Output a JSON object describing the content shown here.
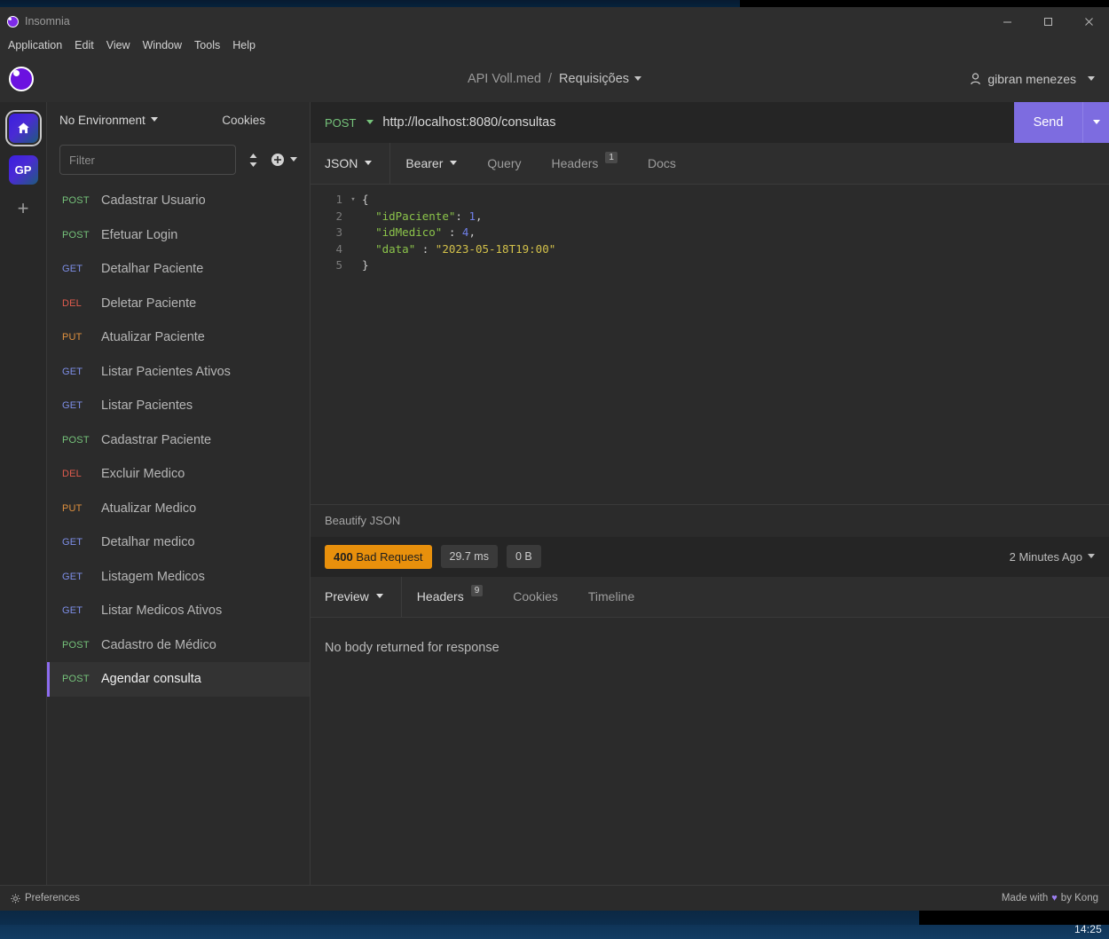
{
  "desktop": {
    "clock": "14:25"
  },
  "window": {
    "title": "Insomnia",
    "controls": {
      "minimize": "minimize-button",
      "maximize": "maximize-button",
      "close": "close-button"
    }
  },
  "menubar": {
    "items": [
      "Application",
      "Edit",
      "View",
      "Window",
      "Tools",
      "Help"
    ]
  },
  "header": {
    "workspace": "API Voll.med",
    "separator": "/",
    "collection": "Requisições",
    "account": "gibran menezes"
  },
  "rail": {
    "home_label": "",
    "project_label": "GP",
    "add_label": "+"
  },
  "sidebar": {
    "environment": "No Environment",
    "cookies": "Cookies",
    "filter_placeholder": "Filter",
    "filter_value": "",
    "requests": [
      {
        "method": "POST",
        "name": "Cadastrar Usuario",
        "selected": false
      },
      {
        "method": "POST",
        "name": "Efetuar Login",
        "selected": false
      },
      {
        "method": "GET",
        "name": "Detalhar Paciente",
        "selected": false
      },
      {
        "method": "DEL",
        "name": "Deletar Paciente",
        "selected": false
      },
      {
        "method": "PUT",
        "name": "Atualizar Paciente",
        "selected": false
      },
      {
        "method": "GET",
        "name": "Listar Pacientes Ativos",
        "selected": false
      },
      {
        "method": "GET",
        "name": "Listar Pacientes",
        "selected": false
      },
      {
        "method": "POST",
        "name": "Cadastrar Paciente",
        "selected": false
      },
      {
        "method": "DEL",
        "name": "Excluir Medico",
        "selected": false
      },
      {
        "method": "PUT",
        "name": "Atualizar Medico",
        "selected": false
      },
      {
        "method": "GET",
        "name": "Detalhar medico",
        "selected": false
      },
      {
        "method": "GET",
        "name": "Listagem Medicos",
        "selected": false
      },
      {
        "method": "GET",
        "name": "Listar Medicos Ativos",
        "selected": false
      },
      {
        "method": "POST",
        "name": "Cadastro de Médico",
        "selected": false
      },
      {
        "method": "POST",
        "name": "Agendar consulta",
        "selected": true
      }
    ]
  },
  "request": {
    "method": "POST",
    "url": "http://localhost:8080/consultas",
    "send_label": "Send",
    "tabs": [
      {
        "label": "JSON",
        "badge": "",
        "caret": true
      },
      {
        "label": "Bearer",
        "badge": "",
        "caret": true
      },
      {
        "label": "Query",
        "badge": "",
        "caret": false
      },
      {
        "label": "Headers",
        "badge": "1",
        "caret": false
      },
      {
        "label": "Docs",
        "badge": "",
        "caret": false
      }
    ],
    "body_lines": [
      {
        "n": "1",
        "fold": "▾",
        "tokens": [
          {
            "t": "{",
            "c": "punc"
          }
        ]
      },
      {
        "n": "2",
        "fold": "",
        "tokens": [
          {
            "t": "  ",
            "c": "punc"
          },
          {
            "t": "\"idPaciente\"",
            "c": "key"
          },
          {
            "t": ": ",
            "c": "punc"
          },
          {
            "t": "1",
            "c": "num"
          },
          {
            "t": ",",
            "c": "punc"
          }
        ]
      },
      {
        "n": "3",
        "fold": "",
        "tokens": [
          {
            "t": "  ",
            "c": "punc"
          },
          {
            "t": "\"idMedico\"",
            "c": "key"
          },
          {
            "t": " : ",
            "c": "punc"
          },
          {
            "t": "4",
            "c": "num"
          },
          {
            "t": ",",
            "c": "punc"
          }
        ]
      },
      {
        "n": "4",
        "fold": "",
        "tokens": [
          {
            "t": "  ",
            "c": "punc"
          },
          {
            "t": "\"data\"",
            "c": "key"
          },
          {
            "t": " : ",
            "c": "punc"
          },
          {
            "t": "\"2023-05-18T19:00\"",
            "c": "str"
          }
        ]
      },
      {
        "n": "5",
        "fold": "",
        "tokens": [
          {
            "t": "}",
            "c": "punc"
          }
        ]
      }
    ],
    "beautify_label": "Beautify JSON"
  },
  "response": {
    "status_code": "400",
    "status_text": "Bad Request",
    "time": "29.7 ms",
    "size": "0 B",
    "age": "2 Minutes Ago",
    "tabs": [
      {
        "label": "Preview",
        "badge": "",
        "caret": true
      },
      {
        "label": "Headers",
        "badge": "9",
        "caret": false
      },
      {
        "label": "Cookies",
        "badge": "",
        "caret": false
      },
      {
        "label": "Timeline",
        "badge": "",
        "caret": false
      }
    ],
    "body_message": "No body returned for response"
  },
  "footer": {
    "preferences": "Preferences",
    "made_prefix": "Made with",
    "heart": "♥",
    "made_suffix": "by Kong"
  },
  "colors": {
    "accent_purple": "#7d6ce0",
    "status_orange": "#e8900c",
    "method_post": "#76c47b",
    "method_get": "#7e8fe8",
    "method_del": "#e05b4e",
    "method_put": "#e0913f"
  }
}
